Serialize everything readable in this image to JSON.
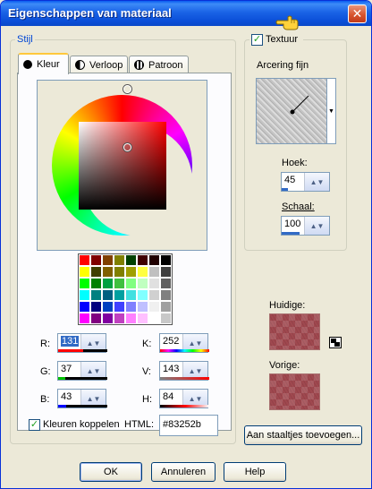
{
  "window": {
    "title": "Eigenschappen van materiaal",
    "close_label": "✕"
  },
  "stijl": {
    "group_label": "Stijl",
    "tabs": [
      {
        "label": "Kleur",
        "icon": "filled-circle-icon",
        "active": true
      },
      {
        "label": "Verloop",
        "icon": "half-circle-icon",
        "active": false
      },
      {
        "label": "Patroon",
        "icon": "pattern-icon",
        "active": false
      }
    ]
  },
  "color": {
    "fields": {
      "R": {
        "label": "R:",
        "value": "131",
        "accent": "#ff0000"
      },
      "G": {
        "label": "G:",
        "value": "37",
        "accent": "#00c000"
      },
      "B": {
        "label": "B:",
        "value": "43",
        "accent": "#0000ff"
      },
      "K": {
        "label": "K:",
        "value": "252",
        "accent": "#ff0000"
      },
      "V": {
        "label": "V:",
        "value": "143",
        "accent": "#ff0000"
      },
      "H": {
        "label": "H:",
        "value": "84",
        "accent": "#ff0000"
      }
    },
    "link_colors_label": "Kleuren koppelen",
    "link_colors_checked": true,
    "html_label": "HTML:",
    "html_value": "#83252b",
    "palette": [
      "#ff0000",
      "#800000",
      "#804000",
      "#808000",
      "#004000",
      "#400000",
      "#200000",
      "#000000",
      "#ffff00",
      "#404000",
      "#806000",
      "#808000",
      "#a0a000",
      "#ffff40",
      "#c0c0c0",
      "#404040",
      "#00ff00",
      "#008000",
      "#00a040",
      "#40c040",
      "#80ff80",
      "#c0ffc0",
      "#e0e0e0",
      "#606060",
      "#00ffff",
      "#008080",
      "#006080",
      "#00a0a0",
      "#40e0e0",
      "#80ffff",
      "#d0d0d0",
      "#808080",
      "#0000ff",
      "#000080",
      "#0040c0",
      "#4040ff",
      "#8080ff",
      "#c0c0ff",
      "#f0f0f0",
      "#a0a0a0",
      "#ff00ff",
      "#800080",
      "#8000a0",
      "#c040c0",
      "#ff80ff",
      "#ffc0ff",
      "#ffffff",
      "#c8c8c8"
    ]
  },
  "texture": {
    "checkbox_label": "Textuur",
    "checked": true,
    "texture_name": "Arcering fijn",
    "hoek_label": "Hoek:",
    "hoek_value": "45",
    "schaal_label": "Schaal:",
    "schaal_value": "100"
  },
  "preview": {
    "huidige_label": "Huidige:",
    "vorige_label": "Vorige:"
  },
  "buttons": {
    "add_swatches": "Aan staaltjes toevoegen...",
    "ok": "OK",
    "cancel": "Annuleren",
    "help": "Help"
  }
}
